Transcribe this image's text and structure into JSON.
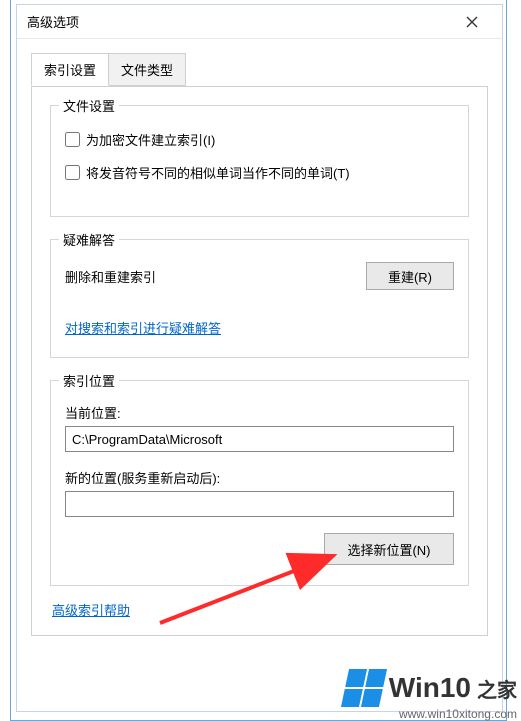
{
  "dialog": {
    "title": "高级选项"
  },
  "tabs": {
    "index_settings": "索引设置",
    "file_types": "文件类型"
  },
  "file_settings": {
    "group_title": "文件设置",
    "encrypted_label": "为加密文件建立索引(I)",
    "diacritic_label": "将发音符号不同的相似单词当作不同的单词(T)"
  },
  "troubleshoot": {
    "group_title": "疑难解答",
    "desc": "删除和重建索引",
    "rebuild_btn": "重建(R)",
    "link": "对搜索和索引进行疑难解答"
  },
  "index_location": {
    "group_title": "索引位置",
    "current_label": "当前位置:",
    "current_value": "C:\\ProgramData\\Microsoft",
    "new_label": "新的位置(服务重新启动后):",
    "new_value": "",
    "select_btn": "选择新位置(N)"
  },
  "help_link": "高级索引帮助",
  "watermark": {
    "brand": "Win10",
    "suffix": "之家",
    "url": "www.win10xitong.com"
  },
  "colors": {
    "link": "#0066cc",
    "arrow": "#ff2a2a",
    "accent": "#1b8ee6"
  }
}
